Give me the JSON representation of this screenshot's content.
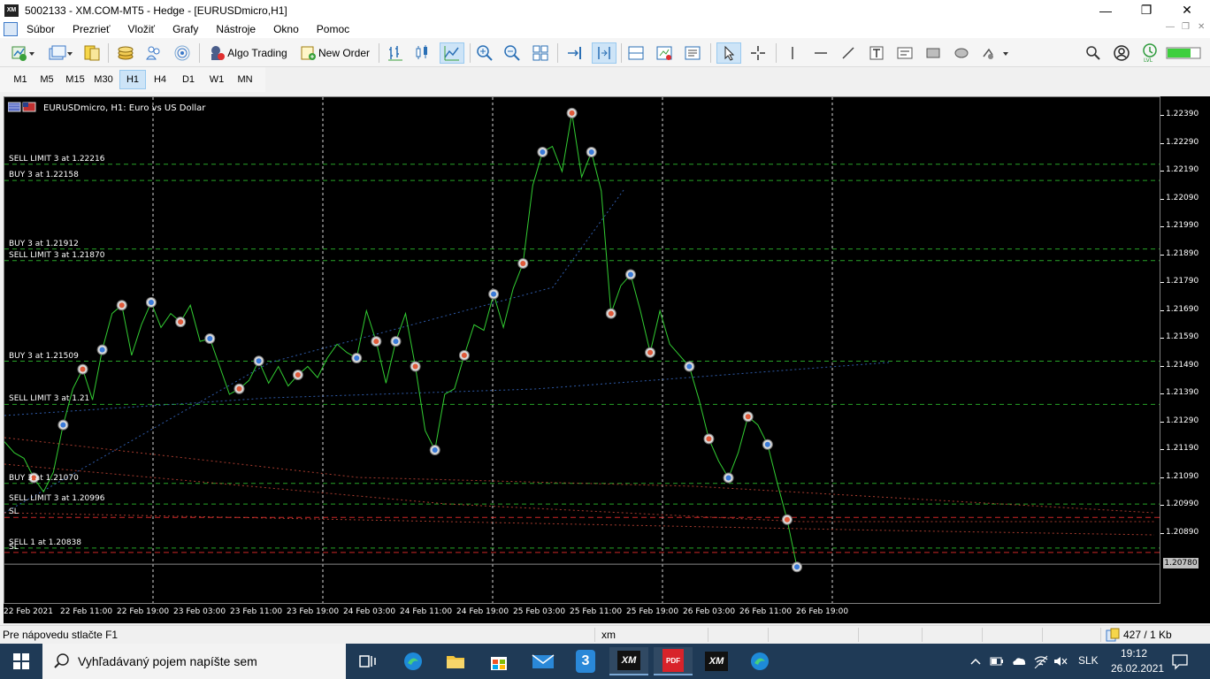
{
  "window": {
    "title": "5002133 - XM.COM-MT5 - Hedge - [EURUSDmicro,H1]",
    "logo": "XM",
    "controls": [
      "—",
      "❐",
      "✕"
    ]
  },
  "menu": {
    "items": [
      "Súbor",
      "Prezrieť",
      "Vložiť",
      "Grafy",
      "Nástroje",
      "Okno",
      "Pomoc"
    ]
  },
  "toolbar": {
    "algo_trading": "Algo Trading",
    "new_order": "New Order"
  },
  "timeframes": {
    "items": [
      "M1",
      "M5",
      "M15",
      "M30",
      "H1",
      "H4",
      "D1",
      "W1",
      "MN"
    ],
    "active": "H1"
  },
  "chart": {
    "title": "EURUSDmicro, H1:  Euro vs US Dollar",
    "colors": {
      "background": "#000000",
      "price_line": "#32cd32",
      "grid": "#ffffff",
      "buy_level": "#32cd32",
      "sl_level": "#ff3030"
    },
    "levels": [
      {
        "label": "SELL LIMIT 3 at 1.22216",
        "price": 1.22216,
        "kind": "order"
      },
      {
        "label": "BUY 3 at 1.22158",
        "price": 1.22158,
        "kind": "order"
      },
      {
        "label": "BUY 3 at 1.21912",
        "price": 1.21912,
        "kind": "order"
      },
      {
        "label": "SELL LIMIT 3 at 1.21870",
        "price": 1.2187,
        "kind": "order"
      },
      {
        "label": "BUY 3 at 1.21509",
        "price": 1.21509,
        "kind": "order"
      },
      {
        "label": "SELL LIMIT 3 at 1.21",
        "price": 1.21354,
        "kind": "order"
      },
      {
        "label": "BUY 3 at 1.21070",
        "price": 1.2107,
        "kind": "order"
      },
      {
        "label": "SELL LIMIT 3 at 1.20996",
        "price": 1.20996,
        "kind": "order"
      },
      {
        "label": "SL",
        "price": 1.20948,
        "kind": "sl"
      },
      {
        "label": "SELL 1 at 1.20838",
        "price": 1.20838,
        "kind": "order"
      },
      {
        "label": "SL",
        "price": 1.20822,
        "kind": "sl"
      }
    ],
    "price_ticks": [
      "1.22390",
      "1.22290",
      "1.22190",
      "1.22090",
      "1.21990",
      "1.21890",
      "1.21790",
      "1.21690",
      "1.21590",
      "1.21490",
      "1.21390",
      "1.21290",
      "1.21190",
      "1.21090",
      "1.20990",
      "1.20890"
    ],
    "current_price": "1.20780",
    "time_ticks": [
      "22 Feb 2021",
      "22 Feb 11:00",
      "22 Feb 19:00",
      "23 Feb 03:00",
      "23 Feb 11:00",
      "23 Feb 19:00",
      "24 Feb 03:00",
      "24 Feb 11:00",
      "24 Feb 19:00",
      "25 Feb 03:00",
      "25 Feb 11:00",
      "25 Feb 19:00",
      "26 Feb 03:00",
      "26 Feb 11:00",
      "26 Feb 19:00"
    ],
    "price_path": [
      1.2122,
      1.2118,
      1.2116,
      1.2109,
      1.2104,
      1.2111,
      1.2128,
      1.2141,
      1.2148,
      1.2137,
      1.2155,
      1.2168,
      1.2171,
      1.2153,
      1.2164,
      1.2172,
      1.2163,
      1.2168,
      1.2165,
      1.2171,
      1.2158,
      1.2159,
      1.2149,
      1.2139,
      1.2141,
      1.2144,
      1.2151,
      1.2143,
      1.2149,
      1.2142,
      1.2146,
      1.2149,
      1.2145,
      1.2152,
      1.2157,
      1.2154,
      1.2152,
      1.2169,
      1.2158,
      1.2143,
      1.2158,
      1.2168,
      1.2149,
      1.2126,
      1.2119,
      1.2139,
      1.2141,
      1.2153,
      1.2164,
      1.2162,
      1.2175,
      1.2163,
      1.2177,
      1.2186,
      1.2214,
      1.2226,
      1.2228,
      1.2219,
      1.224,
      1.2217,
      1.2226,
      1.2212,
      1.2168,
      1.2178,
      1.2182,
      1.2169,
      1.2154,
      1.2169,
      1.2157,
      1.2153,
      1.2149,
      1.2137,
      1.2123,
      1.2115,
      1.2109,
      1.2118,
      1.2131,
      1.2128,
      1.2121,
      1.2107,
      1.2094,
      1.2077
    ]
  },
  "status": {
    "help": "Pre nápovedu stlačte F1",
    "profile": "xm",
    "traffic": "427 / 1 Kb"
  },
  "taskbar": {
    "search_placeholder": "Vyhľadávaný pojem napíšte sem",
    "apps": [
      "task-view",
      "edge",
      "explorer",
      "store",
      "mail",
      "3",
      "XM",
      "PDF",
      "XM",
      "edge"
    ],
    "lang": "SLK",
    "time": "19:12",
    "date": "26.02.2021"
  }
}
